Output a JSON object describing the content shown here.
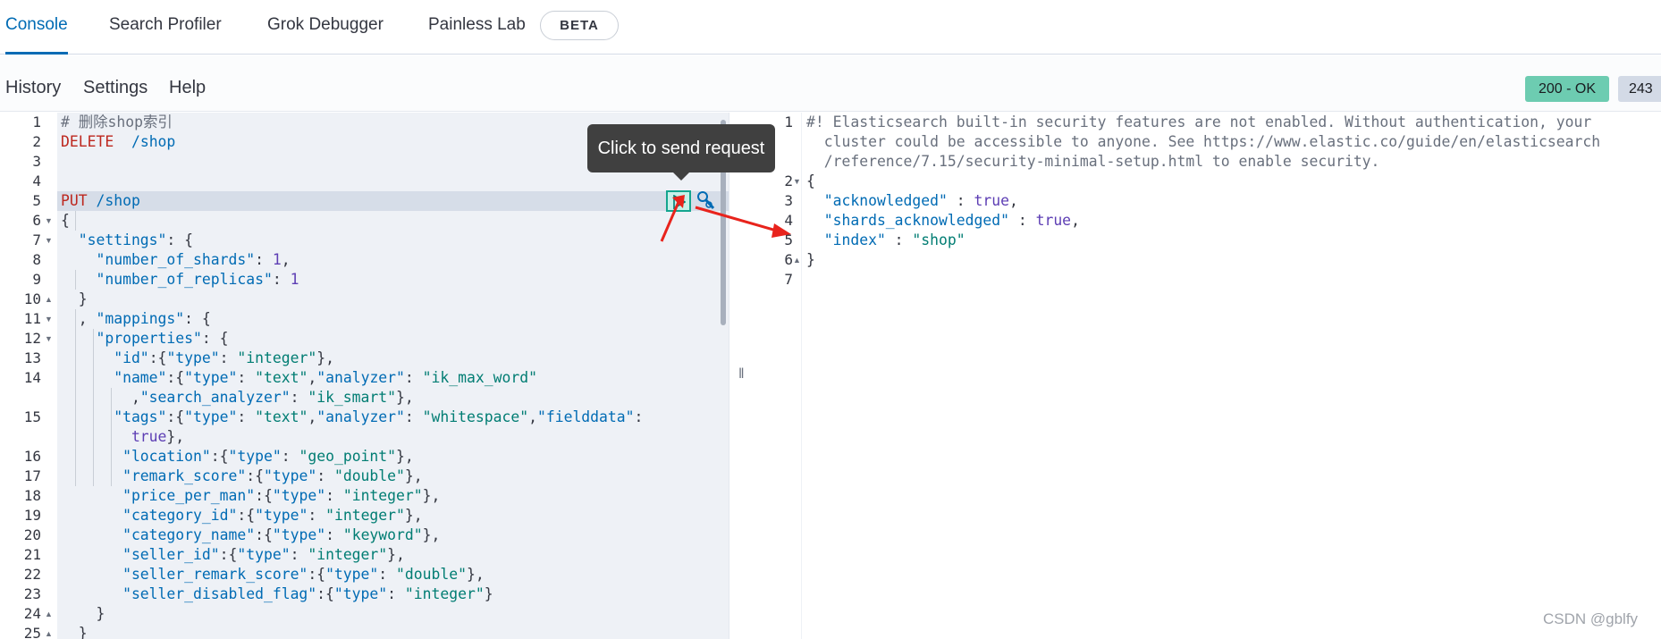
{
  "tabs": [
    {
      "label": "Console",
      "active": true
    },
    {
      "label": "Search Profiler",
      "active": false
    },
    {
      "label": "Grok Debugger",
      "active": false
    },
    {
      "label": "Painless Lab",
      "active": false
    }
  ],
  "beta_badge": "BETA",
  "menu": {
    "history": "History",
    "settings": "Settings",
    "help": "Help"
  },
  "status": {
    "code": "200 - OK",
    "time": "243"
  },
  "tooltip": "Click to send request",
  "watermark": "CSDN @gblfy",
  "request_lines": [
    {
      "n": "1",
      "fold": "",
      "segs": [
        {
          "t": "# 删除shop索引",
          "c": "c-comment"
        }
      ]
    },
    {
      "n": "2",
      "fold": "",
      "segs": [
        {
          "t": "DELETE  ",
          "c": "c-method"
        },
        {
          "t": "/shop",
          "c": "c-path"
        }
      ]
    },
    {
      "n": "3",
      "fold": "",
      "segs": []
    },
    {
      "n": "4",
      "fold": "",
      "segs": []
    },
    {
      "n": "5",
      "fold": "",
      "segs": [
        {
          "t": "PUT ",
          "c": "c-method"
        },
        {
          "t": "/shop",
          "c": "c-path"
        }
      ]
    },
    {
      "n": "6",
      "fold": "▼",
      "segs": [
        {
          "t": "{",
          "c": "c-punct"
        }
      ]
    },
    {
      "n": "7",
      "fold": "▼",
      "segs": [
        {
          "t": "  \"settings\"",
          "c": "c-key"
        },
        {
          "t": ": {",
          "c": "c-punct"
        }
      ]
    },
    {
      "n": "8",
      "fold": "",
      "segs": [
        {
          "t": "    \"number_of_shards\"",
          "c": "c-key"
        },
        {
          "t": ": ",
          "c": "c-punct"
        },
        {
          "t": "1",
          "c": "c-num"
        },
        {
          "t": ",",
          "c": "c-punct"
        }
      ]
    },
    {
      "n": "9",
      "fold": "",
      "segs": [
        {
          "t": "    \"number_of_replicas\"",
          "c": "c-key"
        },
        {
          "t": ": ",
          "c": "c-punct"
        },
        {
          "t": "1",
          "c": "c-num"
        }
      ]
    },
    {
      "n": "10",
      "fold": "▲",
      "segs": [
        {
          "t": "  }",
          "c": "c-punct"
        }
      ]
    },
    {
      "n": "11",
      "fold": "▼",
      "segs": [
        {
          "t": "  , ",
          "c": "c-punct"
        },
        {
          "t": "\"mappings\"",
          "c": "c-key"
        },
        {
          "t": ": {",
          "c": "c-punct"
        }
      ]
    },
    {
      "n": "12",
      "fold": "▼",
      "segs": [
        {
          "t": "    \"properties\"",
          "c": "c-key"
        },
        {
          "t": ": {",
          "c": "c-punct"
        }
      ]
    },
    {
      "n": "13",
      "fold": "",
      "segs": [
        {
          "t": "      \"id\"",
          "c": "c-key"
        },
        {
          "t": ":{",
          "c": "c-punct"
        },
        {
          "t": "\"type\"",
          "c": "c-key"
        },
        {
          "t": ": ",
          "c": "c-punct"
        },
        {
          "t": "\"integer\"",
          "c": "c-str"
        },
        {
          "t": "},",
          "c": "c-punct"
        }
      ]
    },
    {
      "n": "14",
      "fold": "",
      "segs": [
        {
          "t": "      \"name\"",
          "c": "c-key"
        },
        {
          "t": ":{",
          "c": "c-punct"
        },
        {
          "t": "\"type\"",
          "c": "c-key"
        },
        {
          "t": ": ",
          "c": "c-punct"
        },
        {
          "t": "\"text\"",
          "c": "c-str"
        },
        {
          "t": ",",
          "c": "c-punct"
        },
        {
          "t": "\"analyzer\"",
          "c": "c-key"
        },
        {
          "t": ": ",
          "c": "c-punct"
        },
        {
          "t": "\"ik_max_word\"",
          "c": "c-str"
        }
      ]
    },
    {
      "n": "",
      "fold": "",
      "segs": [
        {
          "t": "        ,",
          "c": "c-punct"
        },
        {
          "t": "\"search_analyzer\"",
          "c": "c-key"
        },
        {
          "t": ": ",
          "c": "c-punct"
        },
        {
          "t": "\"ik_smart\"",
          "c": "c-str"
        },
        {
          "t": "},",
          "c": "c-punct"
        }
      ]
    },
    {
      "n": "15",
      "fold": "",
      "segs": [
        {
          "t": "      \"tags\"",
          "c": "c-key"
        },
        {
          "t": ":{",
          "c": "c-punct"
        },
        {
          "t": "\"type\"",
          "c": "c-key"
        },
        {
          "t": ": ",
          "c": "c-punct"
        },
        {
          "t": "\"text\"",
          "c": "c-str"
        },
        {
          "t": ",",
          "c": "c-punct"
        },
        {
          "t": "\"analyzer\"",
          "c": "c-key"
        },
        {
          "t": ": ",
          "c": "c-punct"
        },
        {
          "t": "\"whitespace\"",
          "c": "c-str"
        },
        {
          "t": ",",
          "c": "c-punct"
        },
        {
          "t": "\"fielddata\"",
          "c": "c-key"
        },
        {
          "t": ":",
          "c": "c-punct"
        }
      ]
    },
    {
      "n": "",
      "fold": "",
      "segs": [
        {
          "t": "        true",
          "c": "c-bool"
        },
        {
          "t": "},",
          "c": "c-punct"
        }
      ]
    },
    {
      "n": "16",
      "fold": "",
      "segs": [
        {
          "t": "       \"location\"",
          "c": "c-key"
        },
        {
          "t": ":{",
          "c": "c-punct"
        },
        {
          "t": "\"type\"",
          "c": "c-key"
        },
        {
          "t": ": ",
          "c": "c-punct"
        },
        {
          "t": "\"geo_point\"",
          "c": "c-str"
        },
        {
          "t": "},",
          "c": "c-punct"
        }
      ]
    },
    {
      "n": "17",
      "fold": "",
      "segs": [
        {
          "t": "       \"remark_score\"",
          "c": "c-key"
        },
        {
          "t": ":{",
          "c": "c-punct"
        },
        {
          "t": "\"type\"",
          "c": "c-key"
        },
        {
          "t": ": ",
          "c": "c-punct"
        },
        {
          "t": "\"double\"",
          "c": "c-str"
        },
        {
          "t": "},",
          "c": "c-punct"
        }
      ]
    },
    {
      "n": "18",
      "fold": "",
      "segs": [
        {
          "t": "       \"price_per_man\"",
          "c": "c-key"
        },
        {
          "t": ":{",
          "c": "c-punct"
        },
        {
          "t": "\"type\"",
          "c": "c-key"
        },
        {
          "t": ": ",
          "c": "c-punct"
        },
        {
          "t": "\"integer\"",
          "c": "c-str"
        },
        {
          "t": "},",
          "c": "c-punct"
        }
      ]
    },
    {
      "n": "19",
      "fold": "",
      "segs": [
        {
          "t": "       \"category_id\"",
          "c": "c-key"
        },
        {
          "t": ":{",
          "c": "c-punct"
        },
        {
          "t": "\"type\"",
          "c": "c-key"
        },
        {
          "t": ": ",
          "c": "c-punct"
        },
        {
          "t": "\"integer\"",
          "c": "c-str"
        },
        {
          "t": "},",
          "c": "c-punct"
        }
      ]
    },
    {
      "n": "20",
      "fold": "",
      "segs": [
        {
          "t": "       \"category_name\"",
          "c": "c-key"
        },
        {
          "t": ":{",
          "c": "c-punct"
        },
        {
          "t": "\"type\"",
          "c": "c-key"
        },
        {
          "t": ": ",
          "c": "c-punct"
        },
        {
          "t": "\"keyword\"",
          "c": "c-str"
        },
        {
          "t": "},",
          "c": "c-punct"
        }
      ]
    },
    {
      "n": "21",
      "fold": "",
      "segs": [
        {
          "t": "       \"seller_id\"",
          "c": "c-key"
        },
        {
          "t": ":{",
          "c": "c-punct"
        },
        {
          "t": "\"type\"",
          "c": "c-key"
        },
        {
          "t": ": ",
          "c": "c-punct"
        },
        {
          "t": "\"integer\"",
          "c": "c-str"
        },
        {
          "t": "},",
          "c": "c-punct"
        }
      ]
    },
    {
      "n": "22",
      "fold": "",
      "segs": [
        {
          "t": "       \"seller_remark_score\"",
          "c": "c-key"
        },
        {
          "t": ":{",
          "c": "c-punct"
        },
        {
          "t": "\"type\"",
          "c": "c-key"
        },
        {
          "t": ": ",
          "c": "c-punct"
        },
        {
          "t": "\"double\"",
          "c": "c-str"
        },
        {
          "t": "},",
          "c": "c-punct"
        }
      ]
    },
    {
      "n": "23",
      "fold": "",
      "segs": [
        {
          "t": "       \"seller_disabled_flag\"",
          "c": "c-key"
        },
        {
          "t": ":{",
          "c": "c-punct"
        },
        {
          "t": "\"type\"",
          "c": "c-key"
        },
        {
          "t": ": ",
          "c": "c-punct"
        },
        {
          "t": "\"integer\"",
          "c": "c-str"
        },
        {
          "t": "}",
          "c": "c-punct"
        }
      ]
    },
    {
      "n": "24",
      "fold": "▲",
      "segs": [
        {
          "t": "    }",
          "c": "c-punct"
        }
      ]
    },
    {
      "n": "25",
      "fold": "▲",
      "segs": [
        {
          "t": "  }",
          "c": "c-punct"
        }
      ]
    }
  ],
  "response_lines": [
    {
      "n": "1",
      "fold": "",
      "segs": [
        {
          "t": "#! Elasticsearch built-in security features are not enabled. Without authentication, your",
          "c": "c-comment"
        }
      ]
    },
    {
      "n": "",
      "fold": "",
      "segs": [
        {
          "t": "  cluster could be accessible to anyone. See https://www.elastic.co/guide/en/elasticsearch",
          "c": "c-comment"
        }
      ]
    },
    {
      "n": "",
      "fold": "",
      "segs": [
        {
          "t": "  /reference/7.15/security-minimal-setup.html to enable security.",
          "c": "c-comment"
        }
      ]
    },
    {
      "n": "2",
      "fold": "▼",
      "segs": [
        {
          "t": "{",
          "c": "c-punct"
        }
      ]
    },
    {
      "n": "3",
      "fold": "",
      "segs": [
        {
          "t": "  \"acknowledged\"",
          "c": "c-key"
        },
        {
          "t": " : ",
          "c": "c-punct"
        },
        {
          "t": "true",
          "c": "c-bool"
        },
        {
          "t": ",",
          "c": "c-punct"
        }
      ]
    },
    {
      "n": "4",
      "fold": "",
      "segs": [
        {
          "t": "  \"shards_acknowledged\"",
          "c": "c-key"
        },
        {
          "t": " : ",
          "c": "c-punct"
        },
        {
          "t": "true",
          "c": "c-bool"
        },
        {
          "t": ",",
          "c": "c-punct"
        }
      ]
    },
    {
      "n": "5",
      "fold": "",
      "segs": [
        {
          "t": "  \"index\"",
          "c": "c-key"
        },
        {
          "t": " : ",
          "c": "c-punct"
        },
        {
          "t": "\"shop\"",
          "c": "c-str"
        }
      ]
    },
    {
      "n": "6",
      "fold": "▲",
      "segs": [
        {
          "t": "}",
          "c": "c-punct"
        }
      ]
    },
    {
      "n": "7",
      "fold": "",
      "segs": []
    }
  ]
}
